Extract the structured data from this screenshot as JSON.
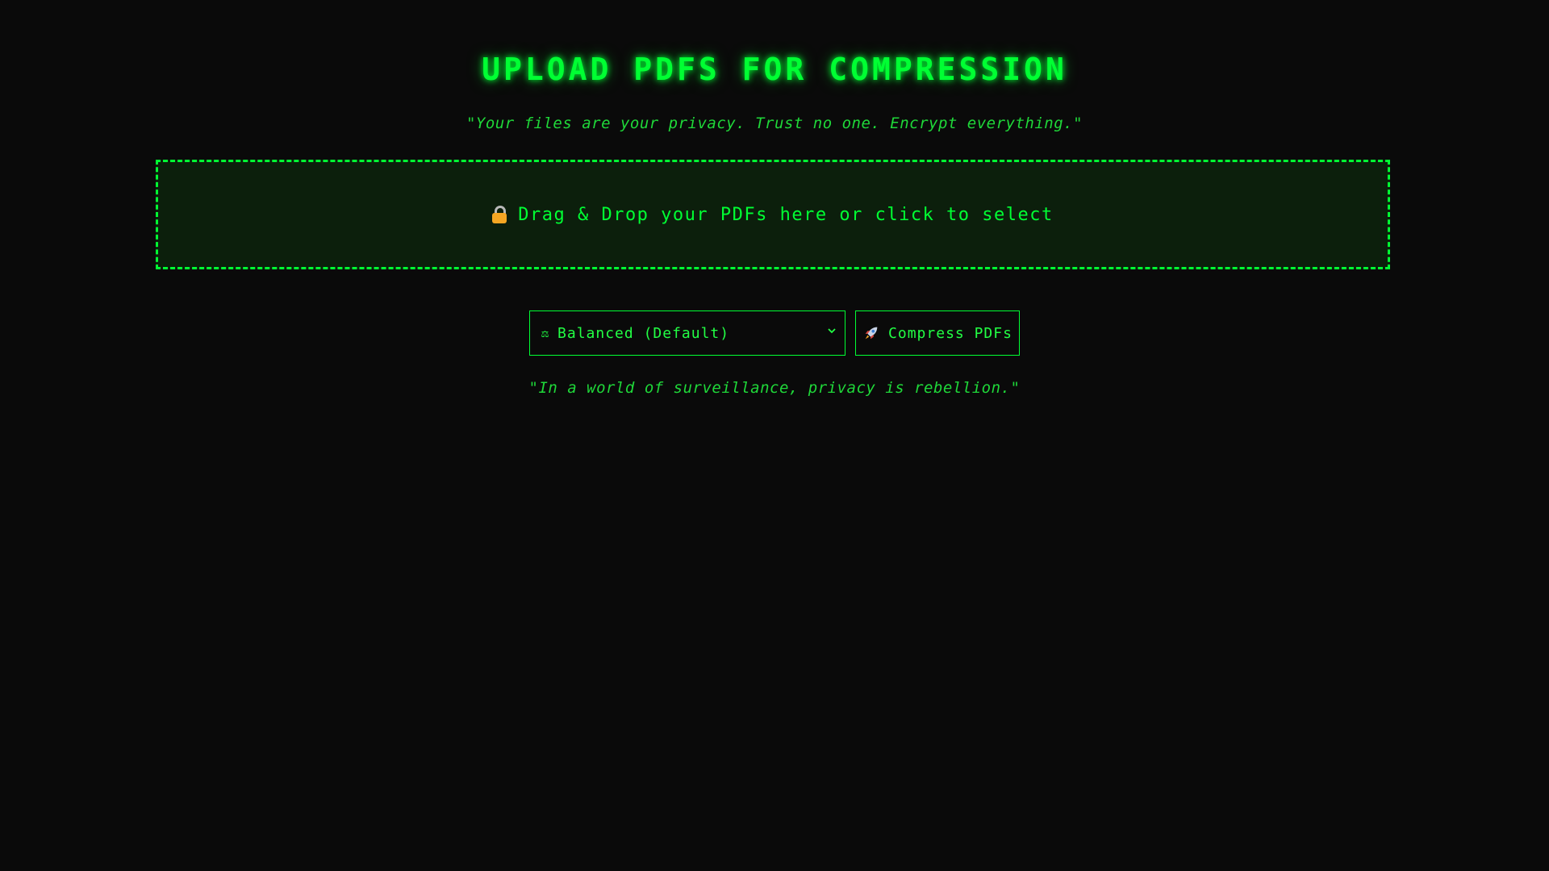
{
  "header": {
    "title": "UPLOAD PDFS FOR COMPRESSION",
    "quote_top": "\"Your files are your privacy. Trust no one. Encrypt everything.\""
  },
  "dropzone": {
    "label": "Drag & Drop your PDFs here or click to select",
    "icon": "lock-icon"
  },
  "controls": {
    "compression_level": {
      "selected": "Balanced (Default)",
      "icon": "scale-icon"
    },
    "compress_button": {
      "label": "Compress PDFs",
      "icon": "rocket-icon"
    }
  },
  "footer": {
    "quote_bottom": "\"In a world of surveillance, privacy is rebellion.\""
  },
  "colors": {
    "background": "#0a0a0a",
    "accent": "#00ff33",
    "dropzone_fill": "#0c1f0c"
  }
}
